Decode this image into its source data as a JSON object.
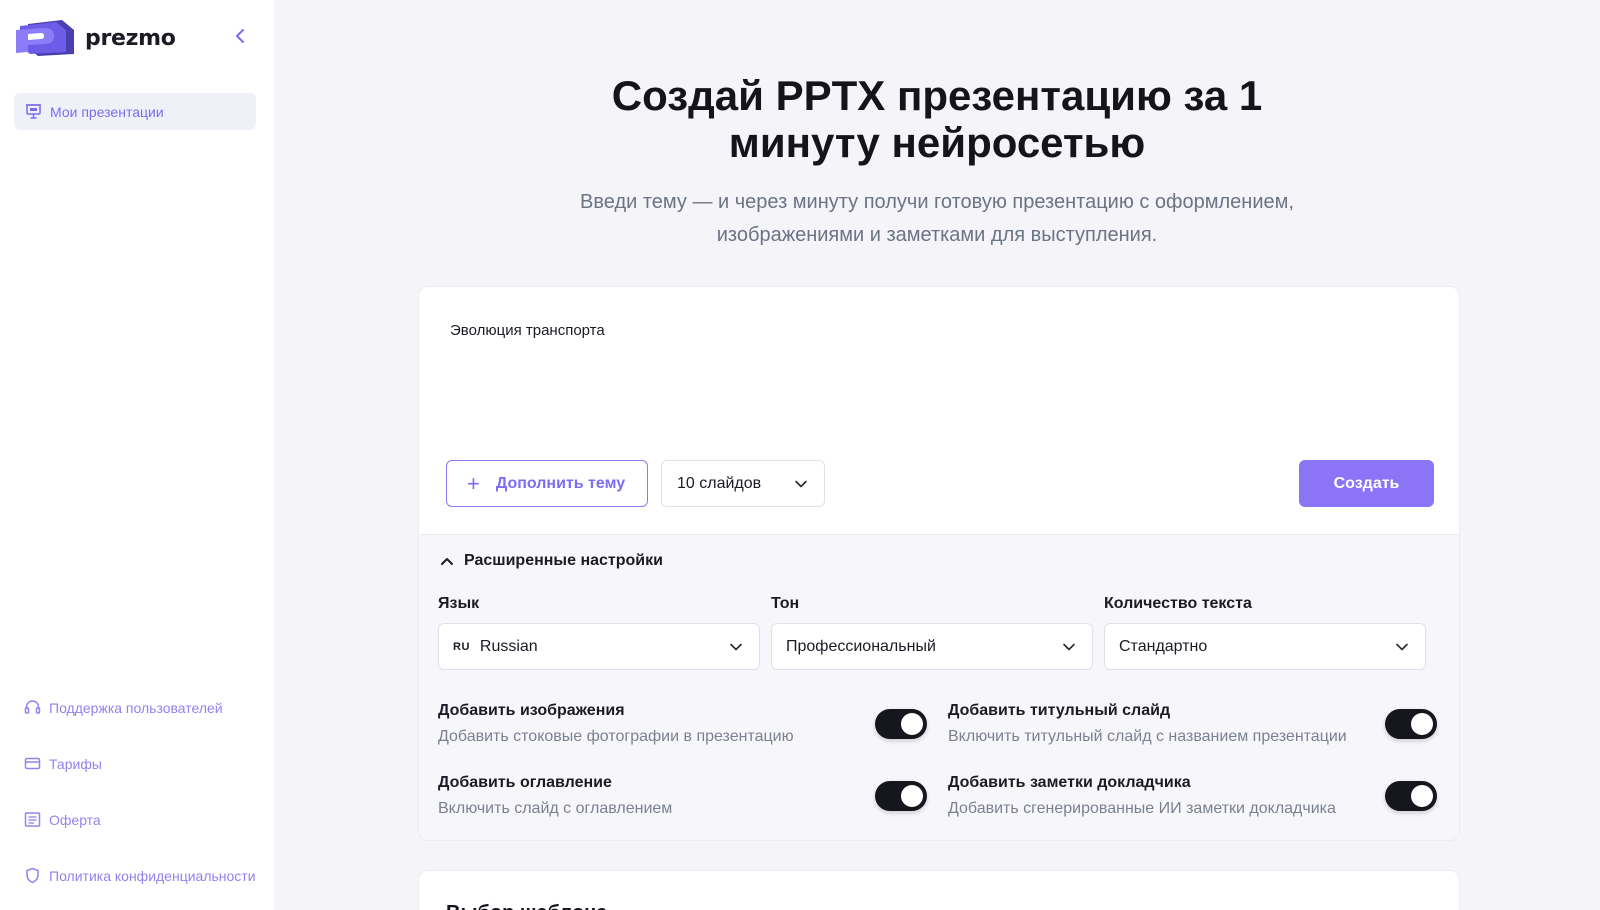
{
  "brand": {
    "name": "prezmo",
    "accent": "#7c6cf2"
  },
  "sidebar": {
    "active_item": {
      "label": "Мои презентации",
      "icon": "presentation-icon"
    },
    "bottom_items": [
      {
        "label": "Поддержка пользователей",
        "icon": "headset-icon"
      },
      {
        "label": "Тарифы",
        "icon": "card-icon"
      },
      {
        "label": "Оферта",
        "icon": "document-icon"
      },
      {
        "label": "Политика конфиденциальности",
        "icon": "shield-icon"
      }
    ]
  },
  "hero": {
    "title_line1": "Создай PPTX презентацию за 1",
    "title_line2": "минуту нейросетью",
    "subtitle_line1": "Введи тему — и через минуту получи готовую презентацию с оформлением,",
    "subtitle_line2": "изображениями и заметками для выступления."
  },
  "form": {
    "topic_value": "Эволюция транспорта",
    "extend_button": "Дополнить тему",
    "slides_value": "10 слайдов",
    "create_button": "Создать"
  },
  "advanced": {
    "toggle_label": "Расширенные настройки",
    "language": {
      "label": "Язык",
      "flag": "RU",
      "value": "Russian"
    },
    "tone": {
      "label": "Тон",
      "value": "Профессиональный"
    },
    "text_amount": {
      "label": "Количество текста",
      "value": "Стандартно"
    },
    "options": [
      {
        "title": "Добавить изображения",
        "desc": "Добавить стоковые фотографии в презентацию",
        "enabled": true
      },
      {
        "title": "Добавить титульный слайд",
        "desc": "Включить титульный слайд с названием презентации",
        "enabled": true
      },
      {
        "title": "Добавить оглавление",
        "desc": "Включить слайд с оглавлением",
        "enabled": true
      },
      {
        "title": "Добавить заметки докладчика",
        "desc": "Добавить сгенерированные ИИ заметки докладчика",
        "enabled": true
      }
    ]
  },
  "template_section": {
    "title": "Выбор шаблона"
  }
}
